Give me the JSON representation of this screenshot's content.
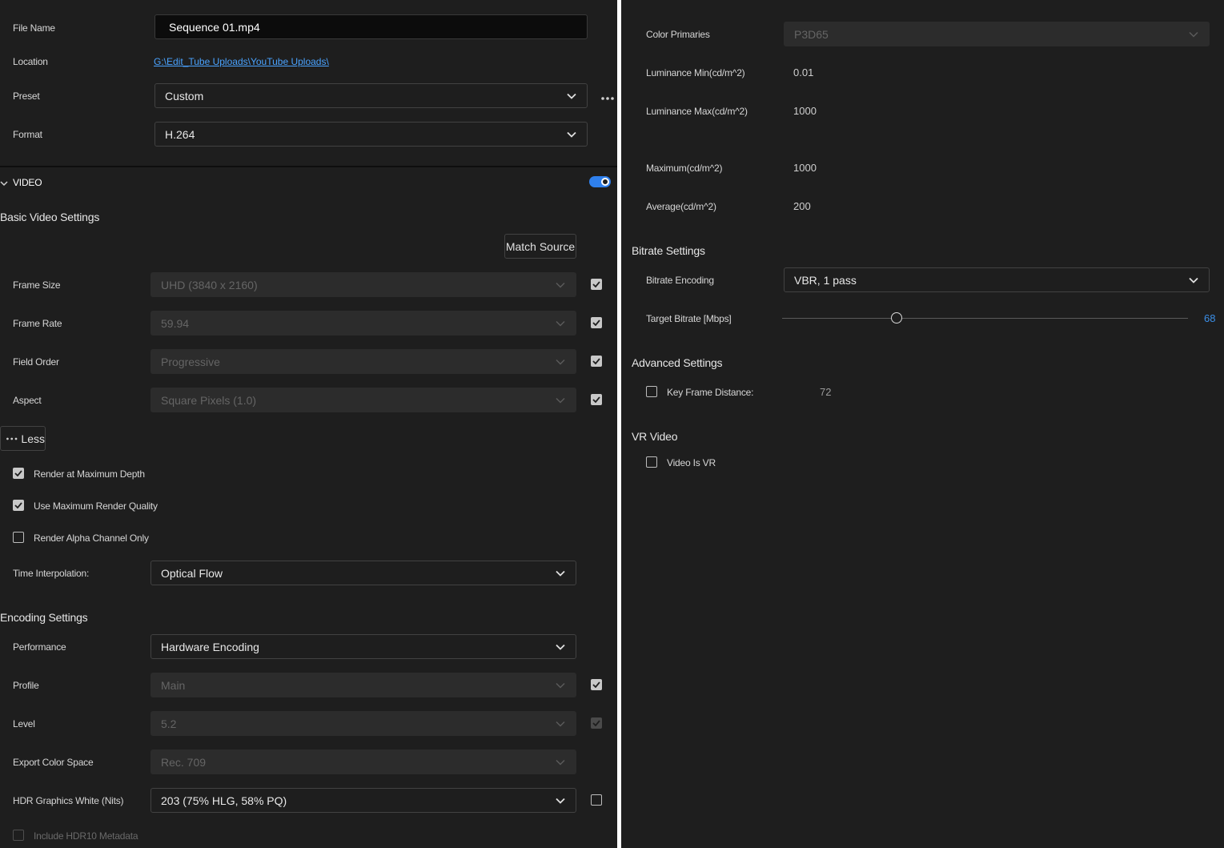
{
  "left": {
    "file_name_label": "File Name",
    "file_name_value": "Sequence 01.mp4",
    "location_label": "Location",
    "location_value": "G:\\Edit_Tube Uploads\\YouTube Uploads\\",
    "preset_label": "Preset",
    "preset_value": "Custom",
    "format_label": "Format",
    "format_value": "H.264",
    "video_section": "VIDEO",
    "video_enabled": true,
    "basic_video_settings": "Basic Video Settings",
    "match_source": "Match Source",
    "frame_size_label": "Frame Size",
    "frame_size_value": "UHD (3840 x 2160)",
    "frame_size_checked": true,
    "frame_rate_label": "Frame Rate",
    "frame_rate_value": "59.94",
    "frame_rate_checked": true,
    "field_order_label": "Field Order",
    "field_order_value": "Progressive",
    "field_order_checked": true,
    "aspect_label": "Aspect",
    "aspect_value": "Square Pixels (1.0)",
    "aspect_checked": true,
    "less_button": "Less",
    "render_max_depth": "Render at Maximum Depth",
    "render_max_depth_checked": true,
    "use_max_quality": "Use Maximum Render Quality",
    "use_max_quality_checked": true,
    "render_alpha": "Render Alpha Channel Only",
    "render_alpha_checked": false,
    "time_interp_label": "Time Interpolation:",
    "time_interp_value": "Optical Flow",
    "encoding_settings": "Encoding Settings",
    "performance_label": "Performance",
    "performance_value": "Hardware Encoding",
    "profile_label": "Profile",
    "profile_value": "Main",
    "profile_checked": true,
    "level_label": "Level",
    "level_value": "5.2",
    "level_checked": true,
    "export_color_label": "Export Color Space",
    "export_color_value": "Rec. 709",
    "hdr_white_label": "HDR Graphics White (Nits)",
    "hdr_white_value": "203 (75% HLG, 58% PQ)",
    "hdr_white_checked": false,
    "include_hdr10": "Include HDR10 Metadata",
    "include_hdr10_checked": false
  },
  "right": {
    "color_primaries_label": "Color Primaries",
    "color_primaries_value": "P3D65",
    "lum_min_label": "Luminance Min(cd/m^2)",
    "lum_min_value": "0.01",
    "lum_max_label": "Luminance Max(cd/m^2)",
    "lum_max_value": "1000",
    "maximum_label": "Maximum(cd/m^2)",
    "maximum_value": "1000",
    "average_label": "Average(cd/m^2)",
    "average_value": "200",
    "bitrate_settings": "Bitrate Settings",
    "bitrate_encoding_label": "Bitrate Encoding",
    "bitrate_encoding_value": "VBR, 1 pass",
    "target_bitrate_label": "Target Bitrate [Mbps]",
    "target_bitrate_value": "68",
    "target_bitrate_fraction": 0.283,
    "advanced_settings": "Advanced Settings",
    "key_frame_label": "Key Frame Distance:",
    "key_frame_checked": false,
    "key_frame_value": "72",
    "vr_video": "VR Video",
    "video_is_vr": "Video Is VR",
    "video_is_vr_checked": false
  },
  "colors": {
    "accent": "#2f80ed",
    "link": "#4aa3ff",
    "bitrate_value": "#3b8fe8",
    "background": "#1e1e1e"
  },
  "icons": [
    "chevron-down-icon",
    "more-options-icon",
    "checkmark-icon",
    "collapse-chevron-icon"
  ]
}
